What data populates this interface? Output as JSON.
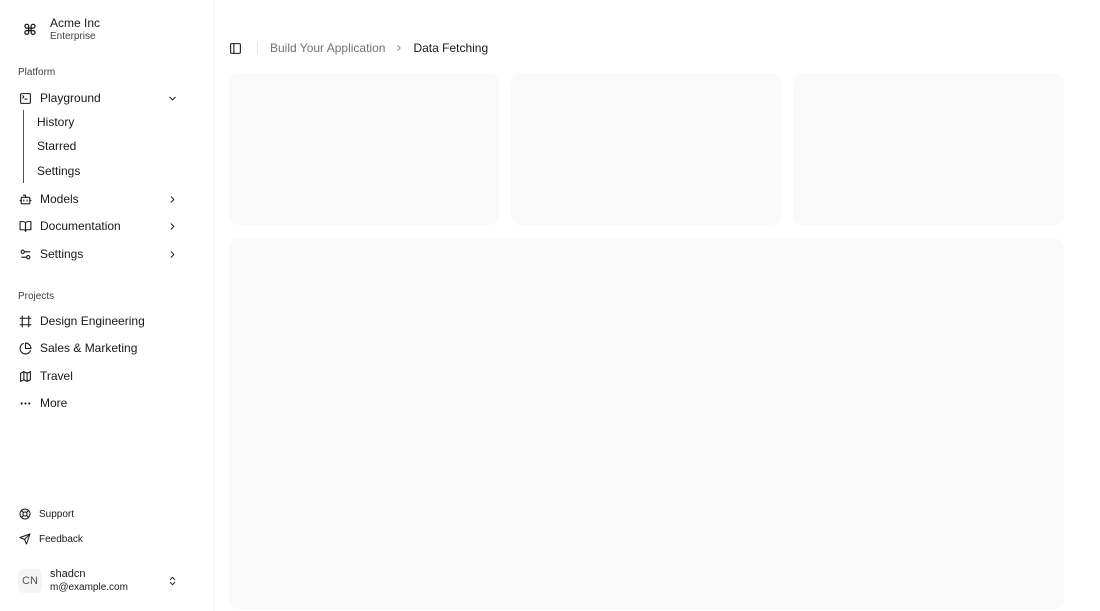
{
  "team": {
    "name": "Acme Inc",
    "plan": "Enterprise",
    "logo_icon": "command-icon"
  },
  "sidebar": {
    "platform_label": "Platform",
    "platform_items": [
      {
        "label": "Playground",
        "icon": "terminal-square-icon",
        "expanded": true,
        "sub_items": [
          "History",
          "Starred",
          "Settings"
        ]
      },
      {
        "label": "Models",
        "icon": "bot-icon",
        "expanded": false
      },
      {
        "label": "Documentation",
        "icon": "book-open-icon",
        "expanded": false
      },
      {
        "label": "Settings",
        "icon": "settings-2-icon",
        "expanded": false
      }
    ],
    "projects_label": "Projects",
    "projects": [
      {
        "label": "Design Engineering",
        "icon": "frame-icon"
      },
      {
        "label": "Sales & Marketing",
        "icon": "pie-chart-icon"
      },
      {
        "label": "Travel",
        "icon": "map-icon"
      },
      {
        "label": "More",
        "icon": "more-horizontal-icon"
      }
    ],
    "footer_links": [
      {
        "label": "Support",
        "icon": "life-buoy-icon"
      },
      {
        "label": "Feedback",
        "icon": "send-icon"
      }
    ]
  },
  "user": {
    "initials": "CN",
    "name": "shadcn",
    "email": "m@example.com"
  },
  "breadcrumb": {
    "parent": "Build Your Application",
    "current": "Data Fetching"
  },
  "colors": {
    "card_bg": "#fafafa",
    "text": "#18181b",
    "muted": "#71717a"
  }
}
